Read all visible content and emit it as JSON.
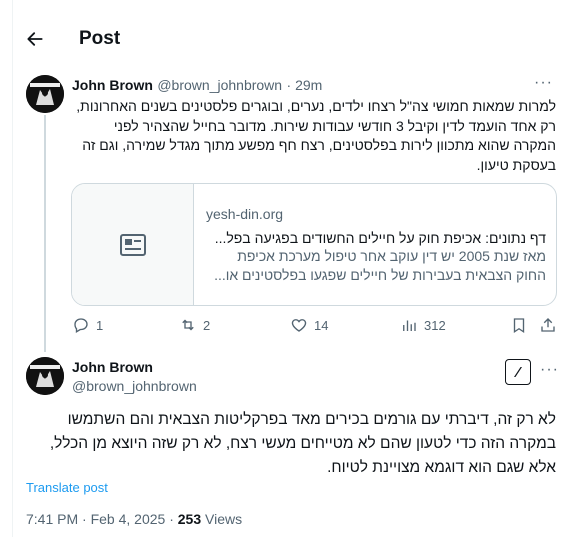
{
  "header": {
    "title": "Post"
  },
  "reply_tweet": {
    "name": "John Brown",
    "handle": "@brown_johnbrown",
    "time": "· 29m",
    "text": "למרות שמאות חמושי צה\"ל רצחו ילדים, נערים, ובוגרים פלסטינים  בשנים האחרונות, רק אחד הועמד לדין וקיבל 3 חודשי עבודות שירות. מדובר בחייל שהצהיר לפני המקרה שהוא מתכוון לירות בפלסטינים, רצח חף מפשע מתוך מגדל שמירה, וגם זה בעסקת טיעון.",
    "card": {
      "domain": "yesh-din.org",
      "title": "דף נתונים: אכיפת חוק על חיילים החשודים בפגיעה בפל...",
      "description": "מאז שנת 2005 יש דין עוקב אחר טיפול מערכת אכיפת החוק הצבאית בעבירות של חיילים שפגעו בפלסטינים או..."
    },
    "stats": {
      "replies": "1",
      "reposts": "2",
      "likes": "14",
      "views": "312"
    }
  },
  "main_tweet": {
    "name": "John Brown",
    "handle": "@brown_johnbrown",
    "text": "לא רק זה, דיברתי עם גורמים בכירים מאד בפרקליטות הצבאית והם השתמשו במקרה הזה כדי לטעון שהם לא מטייחים מעשי רצח, לא רק שזה היוצא מן הכלל, אלא שגם הוא דוגמא מצויינת לטיוח.",
    "translate_label": "Translate post",
    "timestamp": "7:41 PM · Feb 4, 2025 · ",
    "views_count": "253",
    "views_label": " Views"
  },
  "icons": {
    "back": "arrow-left-icon",
    "reply": "reply-icon",
    "repost": "repost-icon",
    "like": "heart-icon",
    "views": "analytics-icon",
    "bookmark": "bookmark-icon",
    "share": "share-icon",
    "grok": "grok-icon",
    "more": "more-icon",
    "card_placeholder": "article-icon"
  },
  "colors": {
    "link": "#1d9bf0",
    "muted": "#536471",
    "text": "#0f1419",
    "border": "#cfd9de"
  }
}
